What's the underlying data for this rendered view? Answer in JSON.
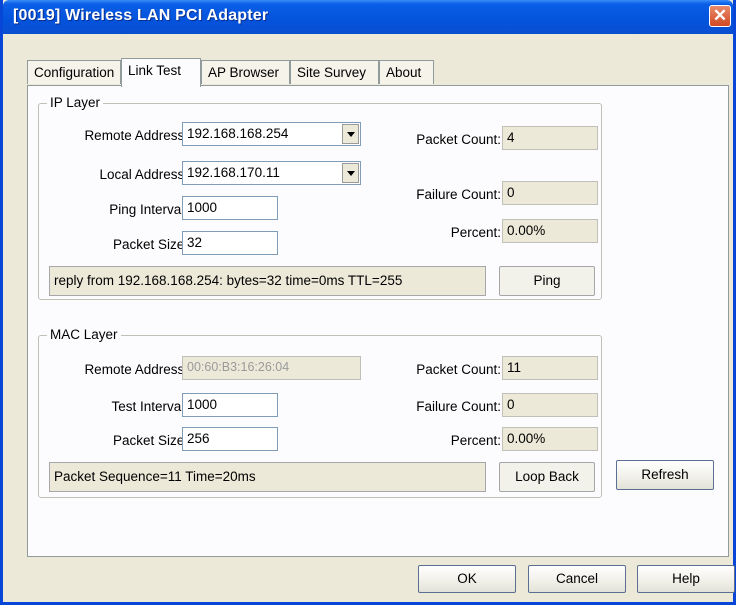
{
  "window": {
    "title": "[0019] Wireless LAN PCI Adapter"
  },
  "tabs": [
    "Configuration",
    "Link Test",
    "AP Browser",
    "Site Survey",
    "About"
  ],
  "ip_layer": {
    "group_label": "IP Layer",
    "remote_address_label": "Remote Address:",
    "remote_address_value": "192.168.168.254",
    "local_address_label": "Local Address:",
    "local_address_value": "192.168.170.11",
    "ping_interval_label": "Ping Interval:",
    "ping_interval_value": "1000",
    "packet_size_label": "Packet Size:",
    "packet_size_value": "32",
    "packet_count_label": "Packet Count:",
    "packet_count_value": "4",
    "failure_count_label": "Failure Count:",
    "failure_count_value": "0",
    "percent_label": "Percent:",
    "percent_value": "0.00%",
    "status_text": "reply from 192.168.168.254: bytes=32 time=0ms TTL=255",
    "ping_button": "Ping"
  },
  "mac_layer": {
    "group_label": "MAC Layer",
    "remote_address_label": "Remote Address:",
    "remote_address_value": "00:60:B3:16:26:04",
    "test_interval_label": "Test Interval:",
    "test_interval_value": "1000",
    "packet_size_label": "Packet Size:",
    "packet_size_value": "256",
    "packet_count_label": "Packet Count:",
    "packet_count_value": "11",
    "failure_count_label": "Failure Count:",
    "failure_count_value": "0",
    "percent_label": "Percent:",
    "percent_value": "0.00%",
    "status_text": "Packet Sequence=11 Time=20ms",
    "loopback_button": "Loop Back",
    "refresh_button": "Refresh"
  },
  "footer": {
    "ok": "OK",
    "cancel": "Cancel",
    "help": "Help"
  },
  "icons": {
    "close": "close-icon",
    "dropdown": "chevron-down-icon"
  },
  "colors": {
    "titlebar": "#0453dc",
    "dialog_bg": "#ece9d8",
    "panel_bg": "#fcfcfe",
    "close_button": "#d24a24"
  }
}
